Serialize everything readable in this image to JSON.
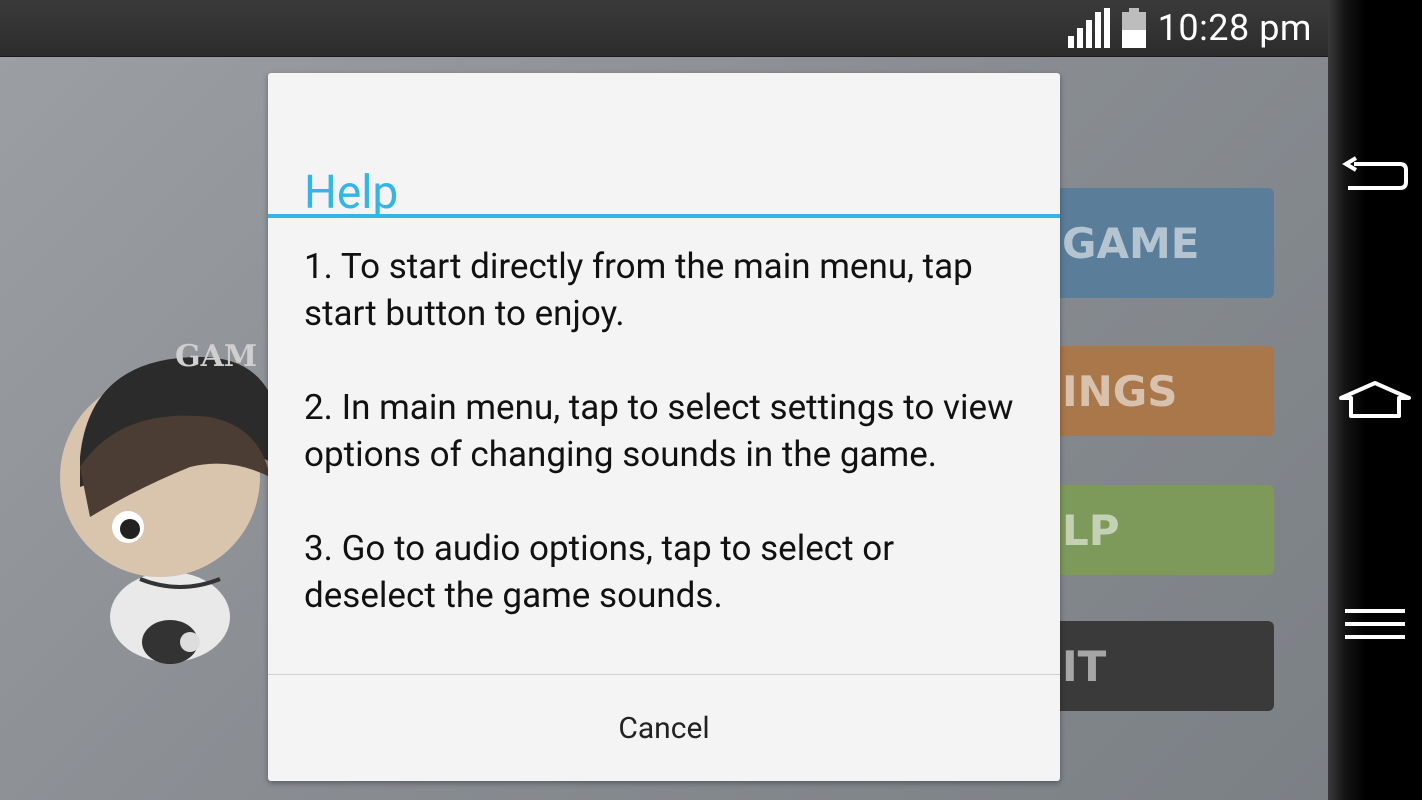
{
  "status_bar": {
    "time": "10:28 pm",
    "signal_level": 4,
    "battery_level": 0.5
  },
  "background_menu": {
    "buttons": [
      {
        "label": "GAME",
        "color": "#4a82b4"
      },
      {
        "label": "INGS",
        "color": "#e8821e"
      },
      {
        "label": "LP",
        "color": "#7cae39"
      },
      {
        "label": "IT",
        "color": "#2b2b2b"
      }
    ],
    "cap_text": "GAM"
  },
  "dialog": {
    "title": "Help",
    "accent_color": "#33b5e5",
    "paragraphs": [
      "1. To start directly from the main menu, tap start button to enjoy.",
      "2. In main menu, tap to select settings to view options of changing sounds in the game.",
      "3. Go to audio options, tap to select or deselect the game sounds."
    ],
    "cancel_label": "Cancel"
  },
  "nav_bar": {
    "back": "back-icon",
    "home": "home-icon",
    "menu": "menu-icon"
  }
}
